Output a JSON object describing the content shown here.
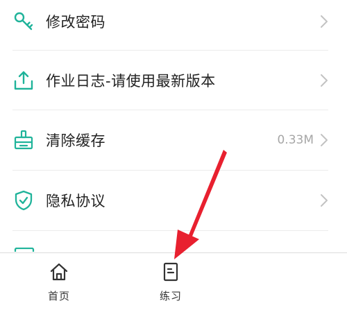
{
  "menu": {
    "items": [
      {
        "label": "修改密码",
        "icon": "key-icon",
        "value": ""
      },
      {
        "label": "作业日志-请使用最新版本",
        "icon": "upload-icon",
        "value": ""
      },
      {
        "label": "清除缓存",
        "icon": "broom-icon",
        "value": "0.33M"
      },
      {
        "label": "隐私协议",
        "icon": "shield-check-icon",
        "value": ""
      }
    ]
  },
  "tabbar": {
    "tabs": [
      {
        "label": "首页",
        "icon": "home-icon"
      },
      {
        "label": "练习",
        "icon": "document-icon"
      }
    ]
  },
  "colors": {
    "accent": "#1fb39a",
    "text": "#222222",
    "muted": "#a6a6a6",
    "chevron": "#c2c2c2",
    "arrow": "#e8202f"
  }
}
